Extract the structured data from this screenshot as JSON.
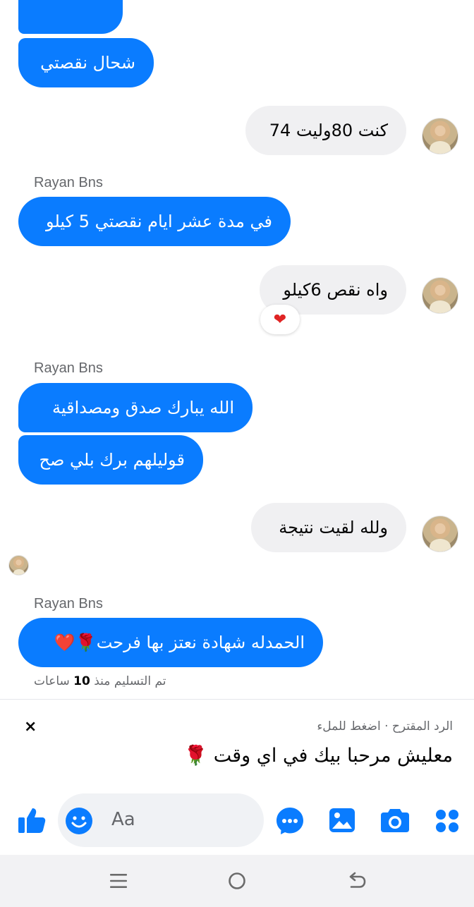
{
  "messages": [
    {
      "id": "m1",
      "side": "me",
      "text": ""
    },
    {
      "id": "m2",
      "side": "me",
      "text": "شحال نقصتي"
    },
    {
      "id": "m3",
      "side": "them",
      "text": "كنت 80وليت 74"
    },
    {
      "id": "m4",
      "side": "me",
      "sender": "Rayan Bns",
      "text": "في مدة عشر ايام نقصتي 5 كيلو"
    },
    {
      "id": "m5",
      "side": "them",
      "text": "واه نقص 6كيلو",
      "reaction": "❤"
    },
    {
      "id": "m6",
      "side": "me",
      "sender": "Rayan Bns",
      "text": "الله يبارك صدق ومصداقية"
    },
    {
      "id": "m7",
      "side": "me",
      "text": "قوليلهم برك بلي صح"
    },
    {
      "id": "m8",
      "side": "them",
      "text": "ولله لقيت نتيجة"
    },
    {
      "id": "m9",
      "side": "me",
      "sender": "Rayan Bns",
      "text": "الحمدله شهادة نعتز بها فرحت🌹❤️"
    }
  ],
  "senders": {
    "s1": "Rayan Bns",
    "s2": "Rayan Bns",
    "s3": "Rayan Bns"
  },
  "status": {
    "delivered_prefix": "تم التسليم منذ",
    "delivered_count": "10",
    "delivered_unit": "ساعات"
  },
  "suggestion": {
    "header": "الرد المقترح · اضغط للملء",
    "text": "معليش مرحبا بيك في اي وقت 🌹",
    "close": "×"
  },
  "composer": {
    "placeholder": "Aa",
    "icons": [
      "like-icon",
      "emoji-icon",
      "chat-icon",
      "gallery-icon",
      "camera-icon",
      "apps-icon"
    ]
  },
  "navbar": {
    "icons": [
      "menu-icon",
      "home-icon",
      "back-icon"
    ]
  },
  "colors": {
    "accent": "#0a7cff",
    "incoming_bubble": "#f0f0f2",
    "secondary_text": "#65676b",
    "reaction_heart": "#e02424"
  }
}
